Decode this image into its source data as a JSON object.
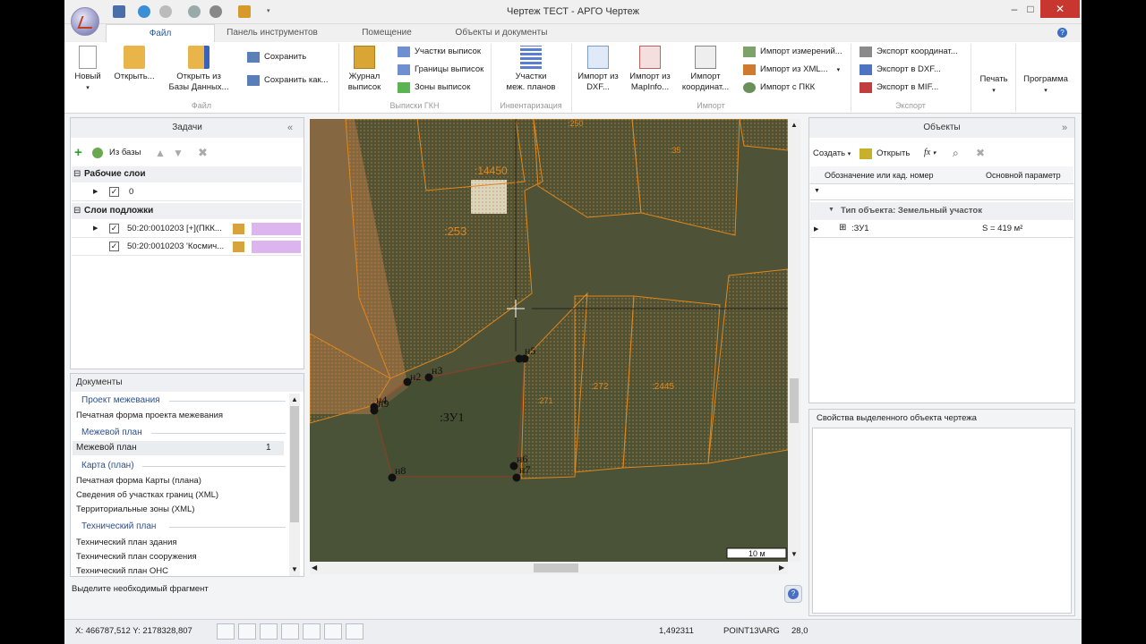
{
  "window": {
    "title": "Чертеж ТЕСТ - АРГО Чертеж",
    "controls": {
      "minimize": "–",
      "maximize": "□",
      "close": "✕"
    }
  },
  "tabs": [
    "Файл",
    "Панель инструментов",
    "Помещение",
    "Объекты и документы"
  ],
  "help_glyph": "?",
  "ribbon": {
    "file": {
      "new": "Новый",
      "open": "Открыть...",
      "open_db_1": "Открыть из",
      "open_db_2": "Базы Данных...",
      "save": "Сохранить",
      "save_as": "Сохранить как...",
      "group": "Файл"
    },
    "gkn": {
      "journal_1": "Журнал",
      "journal_2": "выписок",
      "parcels": "Участки выписок",
      "bounds": "Границы выписок",
      "zones": "Зоны выписок",
      "group": "Выписки ГКН"
    },
    "inv": {
      "plans_1": "Участки",
      "plans_2": "меж. планов",
      "group": "Инвентаризация"
    },
    "imp": {
      "dxf_1": "Импорт из",
      "dxf_2": "DXF...",
      "mapinfo_1": "Импорт из",
      "mapinfo_2": "MapInfo...",
      "coord_1": "Импорт",
      "coord_2": "координат...",
      "meas": "Импорт измерений...",
      "xml": "Импорт из XML...",
      "pkk": "Импорт с ПКК",
      "group": "Импорт"
    },
    "exp": {
      "coords": "Экспорт координат...",
      "dxf": "Экспорт в DXF...",
      "mif": "Экспорт в MIF...",
      "group": "Экспорт"
    },
    "print": "Печать",
    "program": "Программа"
  },
  "tasks": {
    "title": "Задачи",
    "collapse": "«",
    "from_db": "Из базы",
    "working_layers": "Рабочие слои",
    "layer0": "0",
    "base_layers": "Слои подложки",
    "base1": "50:20:0010203 [+](ПКК...",
    "base2": "50:20:0010203 'Космич...",
    "colors": {
      "swatch": "#dcb4ee"
    }
  },
  "documents": {
    "title": "Документы",
    "sec1": "Проект межевания",
    "i1": "Печатная форма проекта межевания",
    "sec2": "Межевой план",
    "i2": "Межевой план",
    "i2_count": "1",
    "sec3": "Карта (план)",
    "i3": "Печатная форма Карты (плана)",
    "i4": "Сведения об участках границ (XML)",
    "i5": "Территориальные зоны (XML)",
    "sec4": "Технический план",
    "i6": "Технический план здания",
    "i7": "Технический план сооружения",
    "i8": "Технический план ОНС"
  },
  "hint": "Выделите необходимый фрагмент",
  "map": {
    "labels": {
      "l1": ":14450",
      "l2": ":253",
      "l3": ":272",
      "l4": ":2445",
      "l5": ":271",
      "l6": ":250",
      "l7": ":35",
      "zu": ":ЗУ1"
    },
    "points": {
      "n2": "н2",
      "n3": "н3",
      "n4": "н4",
      "n5": "н5",
      "n6": "н6",
      "n7": "н7",
      "n8": "н8",
      "n9": "н9"
    },
    "scale": "10 м",
    "colors": {
      "parcel": "#e0871e",
      "boundary": "#d42a1a"
    }
  },
  "objects": {
    "title": "Объекты",
    "collapse": "»",
    "create": "Создать",
    "open": "Открыть",
    "fx": "fx",
    "col1": "Обозначение или кад. номер",
    "col2": "Основной параметр",
    "group_row": "Тип объекта: Земельный участок",
    "item": ":ЗУ1",
    "item_param": "S = 419 м²"
  },
  "properties": {
    "title": "Свойства выделенного объекта чертежа"
  },
  "status": {
    "coords": "X: 466787,512 Y: 2178328,807",
    "scale": "1,492311",
    "snap": "POINT13\\ARG",
    "zoom": "28,0"
  }
}
